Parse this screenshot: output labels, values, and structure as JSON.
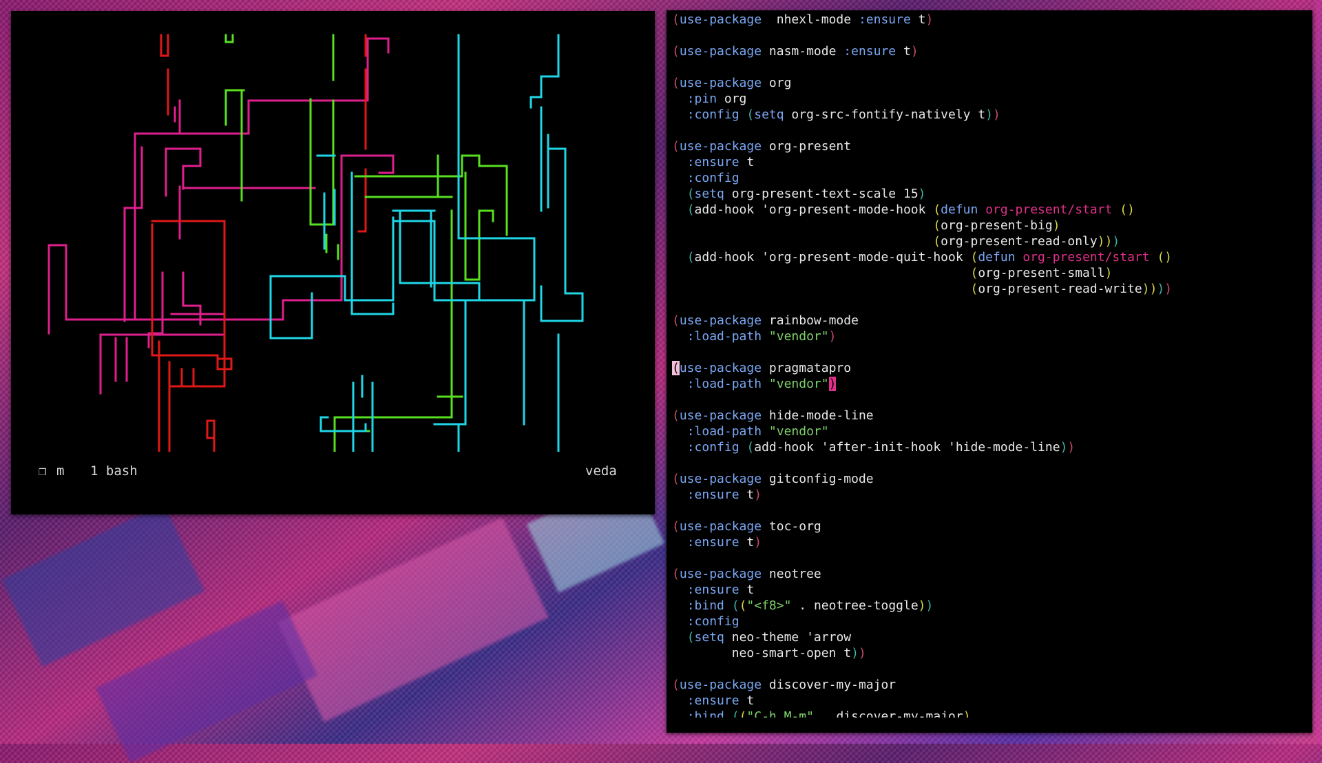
{
  "colors": {
    "pipe_pink": "#e01f8e",
    "pipe_red": "#e01818",
    "pipe_green": "#58e020",
    "pipe_cyan": "#1fd6e6",
    "keyword": "#7aa6f2",
    "string": "#7fd36a",
    "function_name": "#e0308a",
    "paren_1": "#c84d6a",
    "paren_2": "#3fb8a8",
    "paren_3": "#d8d84a"
  },
  "terminal": {
    "session_icon": "❐",
    "session_name": "m",
    "window_label": "1 bash",
    "host": "veda"
  },
  "editor": {
    "lines": [
      [
        [
          "p0",
          "("
        ],
        [
          "kw",
          "use-package"
        ],
        [
          "",
          "  nhexl-mode "
        ],
        [
          "key",
          ":ensure"
        ],
        [
          "",
          " t"
        ],
        [
          "p0",
          ")"
        ]
      ],
      [],
      [
        [
          "p0",
          "("
        ],
        [
          "kw",
          "use-package"
        ],
        [
          "",
          " nasm-mode "
        ],
        [
          "key",
          ":ensure"
        ],
        [
          "",
          " t"
        ],
        [
          "p0",
          ")"
        ]
      ],
      [],
      [
        [
          "p0",
          "("
        ],
        [
          "kw",
          "use-package"
        ],
        [
          "",
          " org"
        ]
      ],
      [
        [
          "",
          "  "
        ],
        [
          "key",
          ":pin"
        ],
        [
          "",
          " org"
        ]
      ],
      [
        [
          "",
          "  "
        ],
        [
          "key",
          ":config"
        ],
        [
          "",
          " "
        ],
        [
          "p1",
          "("
        ],
        [
          "kw",
          "setq"
        ],
        [
          "",
          " org-src-fontify-natively t"
        ],
        [
          "p1",
          ")"
        ],
        [
          "p0",
          ")"
        ]
      ],
      [],
      [
        [
          "p0",
          "("
        ],
        [
          "kw",
          "use-package"
        ],
        [
          "",
          " org-present"
        ]
      ],
      [
        [
          "",
          "  "
        ],
        [
          "key",
          ":ensure"
        ],
        [
          "",
          " t"
        ]
      ],
      [
        [
          "",
          "  "
        ],
        [
          "key",
          ":config"
        ]
      ],
      [
        [
          "",
          "  "
        ],
        [
          "p1",
          "("
        ],
        [
          "kw",
          "setq"
        ],
        [
          "",
          " org-present-text-scale 15"
        ],
        [
          "p1",
          ")"
        ]
      ],
      [
        [
          "",
          "  "
        ],
        [
          "p1",
          "("
        ],
        [
          "",
          "add-hook 'org-present-mode-hook "
        ],
        [
          "p2",
          "("
        ],
        [
          "kw",
          "defun"
        ],
        [
          "",
          " "
        ],
        [
          "fn",
          "org-present/start"
        ],
        [
          "",
          " "
        ],
        [
          "p2",
          "()"
        ]
      ],
      [
        [
          "",
          "                                   "
        ],
        [
          "p2",
          "("
        ],
        [
          "",
          "org-present-big"
        ],
        [
          "p2",
          ")"
        ]
      ],
      [
        [
          "",
          "                                   "
        ],
        [
          "p2",
          "("
        ],
        [
          "",
          "org-present-read-only"
        ],
        [
          "p2",
          ")"
        ],
        [
          "p2",
          ")"
        ],
        [
          "p1",
          ")"
        ]
      ],
      [
        [
          "",
          "  "
        ],
        [
          "p1",
          "("
        ],
        [
          "",
          "add-hook 'org-present-mode-quit-hook "
        ],
        [
          "p2",
          "("
        ],
        [
          "kw",
          "defun"
        ],
        [
          "",
          " "
        ],
        [
          "fn",
          "org-present/start"
        ],
        [
          "",
          " "
        ],
        [
          "p2",
          "()"
        ]
      ],
      [
        [
          "",
          "                                        "
        ],
        [
          "p2",
          "("
        ],
        [
          "",
          "org-present-small"
        ],
        [
          "p2",
          ")"
        ]
      ],
      [
        [
          "",
          "                                        "
        ],
        [
          "p2",
          "("
        ],
        [
          "",
          "org-present-read-write"
        ],
        [
          "p2",
          ")"
        ],
        [
          "p2",
          ")"
        ],
        [
          "p1",
          ")"
        ],
        [
          "p0",
          ")"
        ]
      ],
      [],
      [
        [
          "p0",
          "("
        ],
        [
          "kw",
          "use-package"
        ],
        [
          "",
          " rainbow-mode"
        ]
      ],
      [
        [
          "",
          "  "
        ],
        [
          "key",
          ":load-path"
        ],
        [
          "",
          " "
        ],
        [
          "str",
          "\"vendor\""
        ],
        [
          "p0",
          ")"
        ]
      ],
      [],
      [
        [
          "cursor-left",
          "("
        ],
        [
          "kw",
          "use-package"
        ],
        [
          "",
          " pragmatapro"
        ]
      ],
      [
        [
          "",
          "  "
        ],
        [
          "key",
          ":load-path"
        ],
        [
          "",
          " "
        ],
        [
          "str",
          "\"vendor\""
        ],
        [
          "cursor",
          ")"
        ]
      ],
      [],
      [
        [
          "p0",
          "("
        ],
        [
          "kw",
          "use-package"
        ],
        [
          "",
          " hide-mode-line"
        ]
      ],
      [
        [
          "",
          "  "
        ],
        [
          "key",
          ":load-path"
        ],
        [
          "",
          " "
        ],
        [
          "str",
          "\"vendor\""
        ]
      ],
      [
        [
          "",
          "  "
        ],
        [
          "key",
          ":config"
        ],
        [
          "",
          " "
        ],
        [
          "p1",
          "("
        ],
        [
          "",
          "add-hook 'after-init-hook 'hide-mode-line"
        ],
        [
          "p1",
          ")"
        ],
        [
          "p0",
          ")"
        ]
      ],
      [],
      [
        [
          "p0",
          "("
        ],
        [
          "kw",
          "use-package"
        ],
        [
          "",
          " gitconfig-mode"
        ]
      ],
      [
        [
          "",
          "  "
        ],
        [
          "key",
          ":ensure"
        ],
        [
          "",
          " t"
        ],
        [
          "p0",
          ")"
        ]
      ],
      [],
      [
        [
          "p0",
          "("
        ],
        [
          "kw",
          "use-package"
        ],
        [
          "",
          " toc-org"
        ]
      ],
      [
        [
          "",
          "  "
        ],
        [
          "key",
          ":ensure"
        ],
        [
          "",
          " t"
        ],
        [
          "p0",
          ")"
        ]
      ],
      [],
      [
        [
          "p0",
          "("
        ],
        [
          "kw",
          "use-package"
        ],
        [
          "",
          " neotree"
        ]
      ],
      [
        [
          "",
          "  "
        ],
        [
          "key",
          ":ensure"
        ],
        [
          "",
          " t"
        ]
      ],
      [
        [
          "",
          "  "
        ],
        [
          "key",
          ":bind"
        ],
        [
          "",
          " "
        ],
        [
          "p1",
          "("
        ],
        [
          "p2",
          "("
        ],
        [
          "str",
          "\"<f8>\""
        ],
        [
          "",
          " . neotree-toggle"
        ],
        [
          "p2",
          ")"
        ],
        [
          "p1",
          ")"
        ]
      ],
      [
        [
          "",
          "  "
        ],
        [
          "key",
          ":config"
        ]
      ],
      [
        [
          "",
          "  "
        ],
        [
          "p1",
          "("
        ],
        [
          "kw",
          "setq"
        ],
        [
          "",
          " neo-theme 'arrow"
        ]
      ],
      [
        [
          "",
          "        neo-smart-open t"
        ],
        [
          "p1",
          ")"
        ],
        [
          "p0",
          ")"
        ]
      ],
      [],
      [
        [
          "p0",
          "("
        ],
        [
          "kw",
          "use-package"
        ],
        [
          "",
          " discover-my-major"
        ]
      ],
      [
        [
          "",
          "  "
        ],
        [
          "key",
          ":ensure"
        ],
        [
          "",
          " t"
        ]
      ],
      [
        [
          "",
          "  "
        ],
        [
          "key",
          ":bind"
        ],
        [
          "",
          " "
        ],
        [
          "p1",
          "("
        ],
        [
          "p2",
          "("
        ],
        [
          "str",
          "\"C-h M-m\""
        ],
        [
          "",
          " . discover-my-major"
        ],
        [
          "p2",
          ")"
        ]
      ]
    ]
  }
}
